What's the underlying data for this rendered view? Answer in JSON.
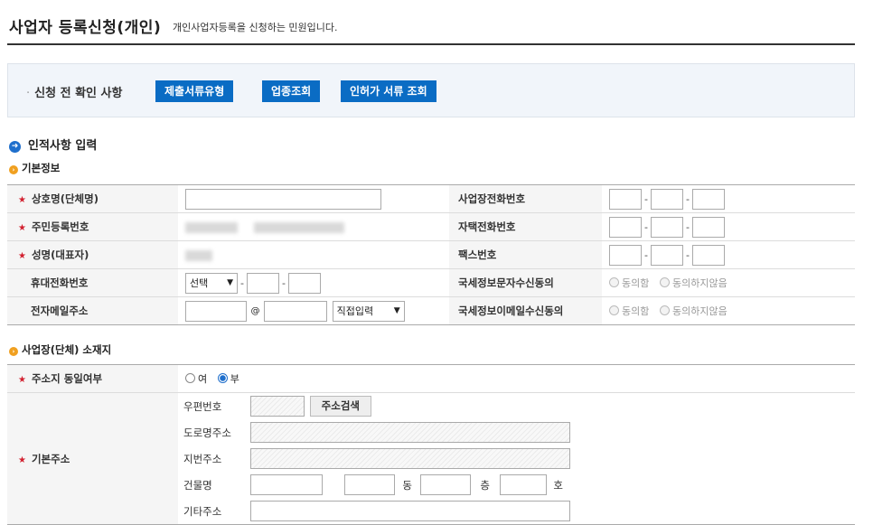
{
  "header": {
    "title": "사업자 등록신청(개인)",
    "description": "개인사업자등록을 신청하는 민원입니다."
  },
  "precheck": {
    "label": "신청 전 확인 사항",
    "buttons": [
      "제출서류유형",
      "업종조회",
      "인허가 서류 조회"
    ]
  },
  "section_personal": {
    "title": "인적사항 입력",
    "basic_info_title": "기본정보",
    "fields": {
      "company_name": "상호명(단체명)",
      "resident_no": "주민등록번호",
      "rep_name": "성명(대표자)",
      "mobile": "휴대전화번호",
      "email": "전자메일주소",
      "biz_phone": "사업장전화번호",
      "home_phone": "자택전화번호",
      "fax": "팩스번호",
      "sms_consent": "국세정보문자수신동의",
      "email_consent": "국세정보이메일수신동의"
    },
    "mobile_select": "선택",
    "email_at": "@",
    "email_domain_select": "직접입력",
    "consent_yes": "동의함",
    "consent_no": "동의하지않음"
  },
  "section_address": {
    "title": "사업장(단체) 소재지",
    "same_address_label": "주소지 동일여부",
    "same_yes": "여",
    "same_no": "부",
    "same_selected": "부",
    "basic_address_label": "기본주소",
    "zipcode_label": "우편번호",
    "search_button": "주소검색",
    "road_address_label": "도로명주소",
    "lot_address_label": "지번주소",
    "building_label": "건물명",
    "dong_unit": "동",
    "floor_unit": "층",
    "room_unit": "호",
    "etc_address_label": "기타주소"
  },
  "colors": {
    "accent_blue": "#0a6cc4",
    "required_star": "#d2202f",
    "sub_bullet": "#f0a020"
  }
}
